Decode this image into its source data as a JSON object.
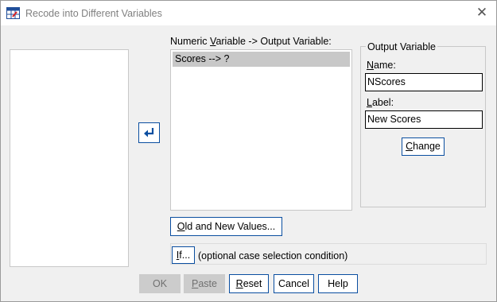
{
  "window": {
    "title": "Recode into Different Variables",
    "close": "✕"
  },
  "mapping": {
    "heading_pre": "Numeric ",
    "heading_key": "V",
    "heading_post": "ariable -> Output Variable:",
    "items": [
      "Scores --> ?"
    ]
  },
  "output": {
    "group_title": "Output Variable",
    "name_key": "N",
    "name_post": "ame:",
    "name_value": "NScores",
    "label_key": "L",
    "label_post": "abel:",
    "label_value": "New Scores",
    "change_pre": "",
    "change_key": "C",
    "change_post": "hange"
  },
  "old_new": {
    "key": "O",
    "post": "ld and New Values..."
  },
  "condition": {
    "if_key": "I",
    "if_post": "f...",
    "text": "(optional case selection condition)"
  },
  "footer": {
    "ok": "OK",
    "paste_key": "P",
    "paste_post": "aste",
    "reset_key": "R",
    "reset_post": "eset",
    "cancel": "Cancel",
    "help": "Help"
  },
  "colors": {
    "accent": "#0a4ea0",
    "selection": "#c8c8c8",
    "disabled": "#cccccc"
  }
}
